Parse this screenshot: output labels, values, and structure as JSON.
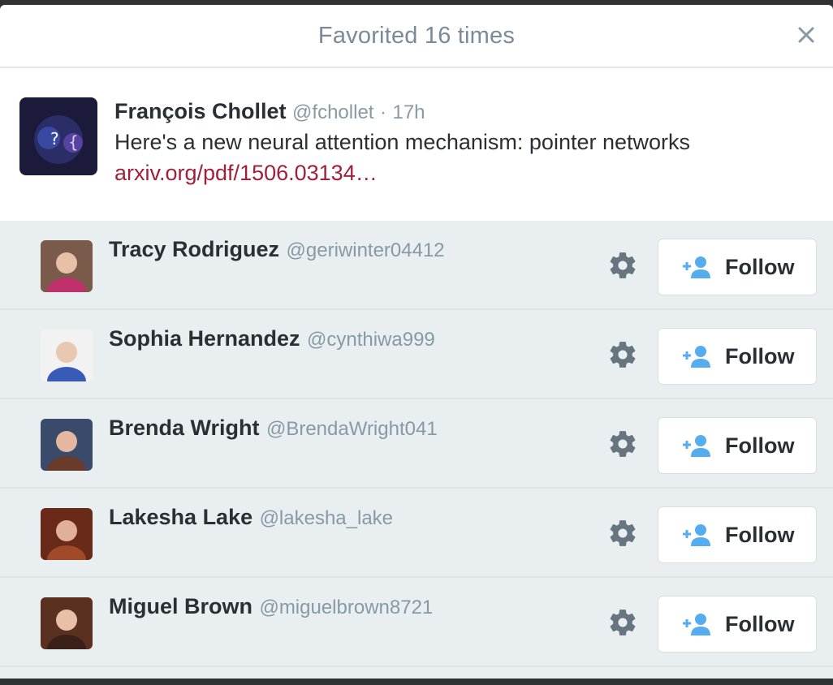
{
  "modal": {
    "title": "Favorited 16 times",
    "close_icon": "close-icon"
  },
  "tweet": {
    "name": "François Chollet",
    "handle": "@fchollet",
    "separator": "·",
    "time": "17h",
    "text": "Here's a new neural attention mechanism: pointer networks",
    "link": "arxiv.org/pdf/1506.03134…"
  },
  "users": [
    {
      "name": "Tracy Rodriguez",
      "handle": "@geriwinter04412",
      "follow_label": "Follow"
    },
    {
      "name": "Sophia Hernandez",
      "handle": "@cynthiwa999",
      "follow_label": "Follow"
    },
    {
      "name": "Brenda Wright",
      "handle": "@BrendaWright041",
      "follow_label": "Follow"
    },
    {
      "name": "Lakesha Lake",
      "handle": "@lakesha_lake",
      "follow_label": "Follow"
    },
    {
      "name": "Miguel Brown",
      "handle": "@miguelbrown8721",
      "follow_label": "Follow"
    }
  ],
  "colors": {
    "accent": "#55acee",
    "link": "#a0203a",
    "muted": "#8899a6",
    "list_bg": "#e9eef1"
  }
}
